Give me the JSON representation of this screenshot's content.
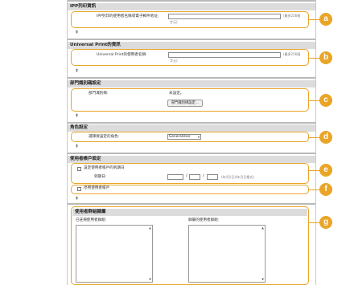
{
  "sections": {
    "ippfax": {
      "title": "IPP列印資訊",
      "label": "IPP列印的使用者名稱或電子郵件地址:",
      "note_line1": "(最多256個",
      "note_line2": "字元)"
    },
    "uprint": {
      "title": "Universal Print的資訊",
      "label": "Universal Print的使用者名稱:",
      "note_line1": "(最多256個",
      "note_line2": "字元)"
    },
    "dept": {
      "title": "部門識別碼設定",
      "label": "部門識別碼:",
      "value": "未設定。",
      "button": "部門識別碼設定..."
    },
    "role": {
      "title": "角色設定",
      "label": "選擇要設定的角色:",
      "selected": "GeneralUser"
    },
    "account": {
      "title": "使用者帳戶設定",
      "expiry_checkbox": "設定使用者帳戶的到期日",
      "expiry_label": "到期日:",
      "date_sep": "/",
      "date_hint": "(年/月/日)(年月日格式)",
      "disable_checkbox": "停用使用者帳戶"
    },
    "groups": {
      "title": "使用者群組隸屬",
      "left_label": "已註冊使用者群組:",
      "right_label": "隸屬的使用者群組:"
    }
  },
  "icons": {
    "top": "up-to-top-icon"
  },
  "callouts": [
    "a",
    "b",
    "c",
    "d",
    "e",
    "f",
    "g"
  ],
  "colors": {
    "accent": "#e9a528",
    "header_bg": "#dcdcdc"
  }
}
